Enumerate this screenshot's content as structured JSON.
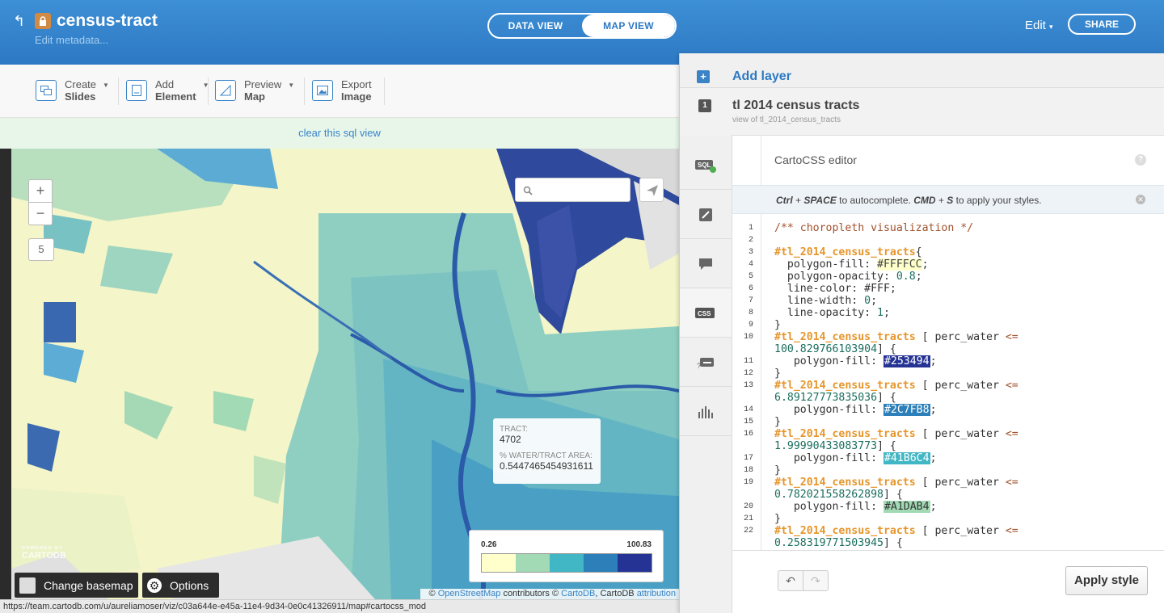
{
  "header": {
    "title": "census-tract",
    "metadata_link": "Edit metadata...",
    "tabs": [
      {
        "label": "DATA VIEW"
      },
      {
        "label": "MAP VIEW"
      }
    ],
    "active_tab": "MAP VIEW",
    "edit_label": "Edit",
    "share_label": "SHARE",
    "brand_color": "#2d79c3"
  },
  "toolbar": {
    "items": [
      {
        "line1": "Create",
        "line2": "Slides",
        "icon": "slides-icon"
      },
      {
        "line1": "Add",
        "line2": "Element",
        "icon": "element-icon"
      },
      {
        "line1": "Preview",
        "line2": "Map",
        "icon": "preview-icon"
      },
      {
        "line1": "Export",
        "line2": "Image",
        "icon": "image-icon"
      }
    ],
    "sql_notice": "clear this sql view"
  },
  "map": {
    "zoom_in": "+",
    "zoom_out": "−",
    "zoom_level": "5",
    "search_placeholder": "",
    "tooltip": {
      "label1": "TRACT:",
      "value1": "4702",
      "label2": "% WATER/TRACT AREA:",
      "value2": "0.5447465454931611"
    },
    "legend": {
      "min": "0.26",
      "max": "100.83",
      "colors": [
        "#FFFFCC",
        "#A1DAB4",
        "#41B6C4",
        "#2C7FB8",
        "#253494"
      ]
    },
    "logo_small": "POWERED BY",
    "logo": "CARTODB",
    "change_basemap": "Change basemap",
    "options": "Options",
    "attribution": {
      "prefix": "©",
      "osm": "OpenStreetMap",
      "mid": "contributors ©",
      "cartodb": "CartoDB",
      "mid2": ", CartoDB",
      "attr": "attribution"
    },
    "status_url": "https://team.cartodb.com/u/aureliamoser/viz/c03a644e-e45a-11e4-9d34-0e0c41326911/map#cartocss_mod"
  },
  "panel": {
    "add_layer": "Add layer",
    "layer_number": "1",
    "layer_title": "tl 2014 census tracts",
    "layer_subtitle": "view of tl_2014_census_tracts",
    "side_tabs": [
      {
        "icon": "sql-icon",
        "label": "SQL"
      },
      {
        "icon": "wizard-icon",
        "label": ""
      },
      {
        "icon": "infowindow-icon",
        "label": ""
      },
      {
        "icon": "css-icon",
        "label": "CSS"
      },
      {
        "icon": "legend-icon",
        "label": ""
      },
      {
        "icon": "filters-icon",
        "label": ""
      }
    ],
    "editor_title": "CartoCSS editor",
    "hint": {
      "k1": "Ctrl",
      "p1": " + ",
      "k2": "SPACE",
      "p2": " to autocomplete. ",
      "k3": "CMD",
      "p3": " + ",
      "k4": "S",
      "p4": " to apply your styles."
    },
    "code": [
      {
        "n": "1",
        "parts": [
          [
            "cm",
            "/** choropleth visualization */"
          ]
        ]
      },
      {
        "n": "2",
        "parts": [
          [
            "kw",
            ""
          ]
        ]
      },
      {
        "n": "3",
        "parts": [
          [
            "sel",
            "#tl_2014_census_tracts"
          ],
          [
            "kw",
            "{"
          ]
        ]
      },
      {
        "n": "4",
        "parts": [
          [
            "kw",
            "  polygon-fill: "
          ],
          [
            "hl",
            "#FFFFCC"
          ],
          [
            "kw",
            ";"
          ]
        ]
      },
      {
        "n": "5",
        "parts": [
          [
            "kw",
            "  polygon-opacity: "
          ],
          [
            "nm",
            "0.8"
          ],
          [
            "kw",
            ";"
          ]
        ]
      },
      {
        "n": "6",
        "parts": [
          [
            "kw",
            "  line-color: #FFF;"
          ]
        ]
      },
      {
        "n": "7",
        "parts": [
          [
            "kw",
            "  line-width: "
          ],
          [
            "nm",
            "0"
          ],
          [
            "kw",
            ";"
          ]
        ]
      },
      {
        "n": "8",
        "parts": [
          [
            "kw",
            "  line-opacity: "
          ],
          [
            "nm",
            "1"
          ],
          [
            "kw",
            ";"
          ]
        ]
      },
      {
        "n": "9",
        "parts": [
          [
            "kw",
            "}"
          ]
        ]
      },
      {
        "n": "10",
        "parts": [
          [
            "sel",
            "#tl_2014_census_tracts"
          ],
          [
            "kw",
            " [ perc_water "
          ],
          [
            "cm",
            "<="
          ]
        ]
      },
      {
        "n": "",
        "parts": [
          [
            "nm",
            "100.829766103904"
          ],
          [
            "kw",
            "] {"
          ]
        ]
      },
      {
        "n": "11",
        "parts": [
          [
            "kw",
            "   polygon-fill: "
          ],
          [
            "sw1",
            "#253494"
          ],
          [
            "kw",
            ";"
          ]
        ]
      },
      {
        "n": "12",
        "parts": [
          [
            "kw",
            "}"
          ]
        ]
      },
      {
        "n": "13",
        "parts": [
          [
            "sel",
            "#tl_2014_census_tracts"
          ],
          [
            "kw",
            " [ perc_water "
          ],
          [
            "cm",
            "<="
          ]
        ]
      },
      {
        "n": "",
        "parts": [
          [
            "nm",
            "6.89127773835036"
          ],
          [
            "kw",
            "] {"
          ]
        ]
      },
      {
        "n": "14",
        "parts": [
          [
            "kw",
            "   polygon-fill: "
          ],
          [
            "sw2",
            "#2C7FB8"
          ],
          [
            "kw",
            ";"
          ]
        ]
      },
      {
        "n": "15",
        "parts": [
          [
            "kw",
            "}"
          ]
        ]
      },
      {
        "n": "16",
        "parts": [
          [
            "sel",
            "#tl_2014_census_tracts"
          ],
          [
            "kw",
            " [ perc_water "
          ],
          [
            "cm",
            "<="
          ]
        ]
      },
      {
        "n": "",
        "parts": [
          [
            "nm",
            "1.99990433083773"
          ],
          [
            "kw",
            "] {"
          ]
        ]
      },
      {
        "n": "17",
        "parts": [
          [
            "kw",
            "   polygon-fill: "
          ],
          [
            "sw3",
            "#41B6C4"
          ],
          [
            "kw",
            ";"
          ]
        ]
      },
      {
        "n": "18",
        "parts": [
          [
            "kw",
            "}"
          ]
        ]
      },
      {
        "n": "19",
        "parts": [
          [
            "sel",
            "#tl_2014_census_tracts"
          ],
          [
            "kw",
            " [ perc_water "
          ],
          [
            "cm",
            "<="
          ]
        ]
      },
      {
        "n": "",
        "parts": [
          [
            "nm",
            "0.782021558262898"
          ],
          [
            "kw",
            "] {"
          ]
        ]
      },
      {
        "n": "20",
        "parts": [
          [
            "kw",
            "   polygon-fill: "
          ],
          [
            "sw4",
            "#A1DAB4"
          ],
          [
            "kw",
            ";"
          ]
        ]
      },
      {
        "n": "21",
        "parts": [
          [
            "kw",
            "}"
          ]
        ]
      },
      {
        "n": "22",
        "parts": [
          [
            "sel",
            "#tl_2014_census_tracts"
          ],
          [
            "kw",
            " [ perc_water "
          ],
          [
            "cm",
            "<="
          ]
        ]
      },
      {
        "n": "",
        "parts": [
          [
            "nm",
            "0.258319771503945"
          ],
          [
            "kw",
            "] {"
          ]
        ]
      }
    ],
    "undo_label": "↶",
    "redo_label": "↷",
    "apply_label": "Apply style"
  }
}
